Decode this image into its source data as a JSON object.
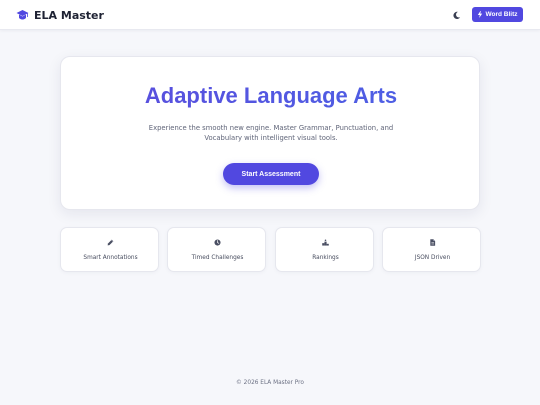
{
  "header": {
    "brand_icon": "graduation-cap-icon",
    "brand_name": "ELA Master",
    "theme_toggle_icon": "moon-icon",
    "word_blitz": {
      "icon": "lightning-bolt-icon",
      "label": "Word Blitz"
    }
  },
  "hero": {
    "title": "Adaptive Language Arts",
    "subtitle": "Experience the smooth new engine. Master Grammar, Punctuation, and Vocabulary with intelligent visual tools.",
    "cta_label": "Start Assessment"
  },
  "features": [
    {
      "icon": "pencil-icon",
      "label": "Smart Annotations"
    },
    {
      "icon": "clock-icon",
      "label": "Timed Challenges"
    },
    {
      "icon": "podium-icon",
      "label": "Rankings"
    },
    {
      "icon": "file-icon",
      "label": "JSON Driven"
    }
  ],
  "footer": {
    "text": "© 2026 ELA Master Pro"
  },
  "colors": {
    "accent": "#5148e0",
    "title_gradient_start": "#5b4bdc",
    "title_gradient_end": "#4a63e6",
    "background": "#f6f7fb",
    "card": "#ffffff"
  }
}
